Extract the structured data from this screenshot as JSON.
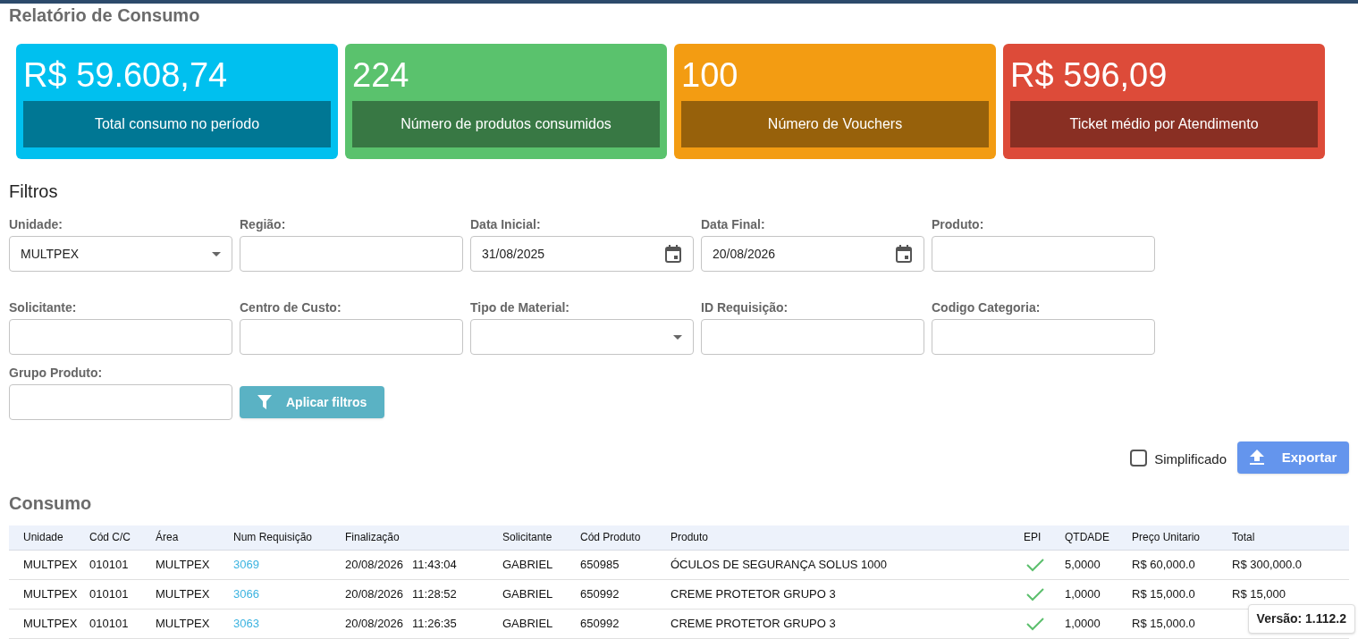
{
  "page_title": "Relatório de Consumo",
  "cards": [
    {
      "value": "R$ 59.608,74",
      "label": "Total consumo no período",
      "color": "#00c0ef"
    },
    {
      "value": "224",
      "label": "Número de produtos consumidos",
      "color": "#5ac26d"
    },
    {
      "value": "100",
      "label": "Número de Vouchers",
      "color": "#f39c12"
    },
    {
      "value": "R$ 596,09",
      "label": "Ticket médio por Atendimento",
      "color": "#dd4b39"
    }
  ],
  "filters": {
    "title": "Filtros",
    "rows": [
      [
        {
          "kind": "select",
          "label": "Unidade:",
          "value": "MULTPEX"
        },
        {
          "kind": "text",
          "label": "Região:"
        },
        {
          "kind": "date",
          "label": "Data Inicial:",
          "value": "31/08/2025"
        },
        {
          "kind": "date",
          "label": "Data Final:",
          "value": "20/08/2026"
        },
        {
          "kind": "text",
          "label": "Produto:"
        }
      ],
      [
        {
          "kind": "text",
          "label": "Solicitante:"
        },
        {
          "kind": "text",
          "label": "Centro de Custo:"
        },
        {
          "kind": "select",
          "label": "Tipo de Material:"
        },
        {
          "kind": "text",
          "label": "ID Requisição:"
        },
        {
          "kind": "text",
          "label": "Codigo Categoria:"
        }
      ],
      [
        {
          "kind": "text",
          "label": "Grupo Produto:"
        }
      ]
    ],
    "apply_button": "Aplicar filtros"
  },
  "simplified": {
    "label": "Simplificado",
    "checked": false
  },
  "export_button": "Exportar",
  "table": {
    "title": "Consumo",
    "columns": [
      "Unidade",
      "Cód C/C",
      "Área",
      "Num Requisição",
      "Finalização",
      "Solicitante",
      "Cód Produto",
      "Produto",
      "EPI",
      "QTDADE",
      "Preço Unitario",
      "Total"
    ],
    "rows": [
      {
        "unidade": "MULTPEX",
        "cc": "010101",
        "area": "MULTPEX",
        "req": "3069",
        "date": "20/08/2026",
        "time": "11:43:04",
        "solicitante": "GABRIEL",
        "cod": "650985",
        "produto": "ÓCULOS DE SEGURANÇA SOLUS 1000",
        "epi": true,
        "qtd": "5,0000",
        "preco": "R$ 60,000.0",
        "total": "R$ 300,000.0"
      },
      {
        "unidade": "MULTPEX",
        "cc": "010101",
        "area": "MULTPEX",
        "req": "3066",
        "date": "20/08/2026",
        "time": "11:28:52",
        "solicitante": "GABRIEL",
        "cod": "650992",
        "produto": "CREME PROTETOR GRUPO 3",
        "epi": true,
        "qtd": "1,0000",
        "preco": "R$ 15,000.0",
        "total": "R$ 15,000"
      },
      {
        "unidade": "MULTPEX",
        "cc": "010101",
        "area": "MULTPEX",
        "req": "3063",
        "date": "20/08/2026",
        "time": "11:26:35",
        "solicitante": "GABRIEL",
        "cod": "650992",
        "produto": "CREME PROTETOR GRUPO 3",
        "epi": true,
        "qtd": "1,0000",
        "preco": "R$ 15,000.0"
      }
    ]
  },
  "version": "Versão: 1.112.2"
}
